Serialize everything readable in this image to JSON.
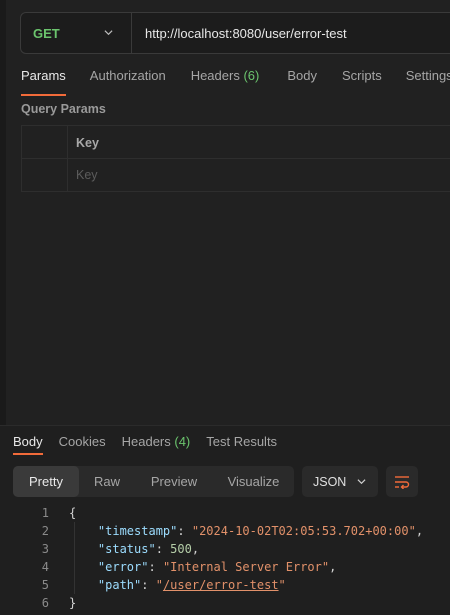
{
  "request": {
    "method": "GET",
    "url": "http://localhost:8080/user/error-test"
  },
  "request_tabs": [
    {
      "label": "Params",
      "count": ""
    },
    {
      "label": "Authorization",
      "count": ""
    },
    {
      "label": "Headers ",
      "count": "(6)"
    },
    {
      "label": "Body",
      "count": ""
    },
    {
      "label": "Scripts",
      "count": ""
    },
    {
      "label": "Settings",
      "count": ""
    }
  ],
  "query_params": {
    "title": "Query Params",
    "key_header": "Key",
    "key_placeholder": "Key"
  },
  "response_tabs": [
    {
      "label": "Body",
      "count": ""
    },
    {
      "label": "Cookies",
      "count": ""
    },
    {
      "label": "Headers ",
      "count": "(4)"
    },
    {
      "label": "Test Results",
      "count": ""
    }
  ],
  "format_tabs": [
    "Pretty",
    "Raw",
    "Preview",
    "Visualize"
  ],
  "format_selected": "Pretty",
  "language_select": "JSON",
  "code_lines": [
    {
      "num": "1",
      "parts": [
        {
          "t": "p",
          "v": "{"
        }
      ]
    },
    {
      "num": "2",
      "parts": [
        {
          "t": "p",
          "v": "    "
        },
        {
          "t": "k",
          "v": "\"timestamp\""
        },
        {
          "t": "p",
          "v": ": "
        },
        {
          "t": "s",
          "v": "\"2024-10-02T02:05:53.702+00:00\""
        },
        {
          "t": "p",
          "v": ","
        }
      ]
    },
    {
      "num": "3",
      "parts": [
        {
          "t": "p",
          "v": "    "
        },
        {
          "t": "k",
          "v": "\"status\""
        },
        {
          "t": "p",
          "v": ": "
        },
        {
          "t": "n",
          "v": "500"
        },
        {
          "t": "p",
          "v": ","
        }
      ]
    },
    {
      "num": "4",
      "parts": [
        {
          "t": "p",
          "v": "    "
        },
        {
          "t": "k",
          "v": "\"error\""
        },
        {
          "t": "p",
          "v": ": "
        },
        {
          "t": "s",
          "v": "\"Internal Server Error\""
        },
        {
          "t": "p",
          "v": ","
        }
      ]
    },
    {
      "num": "5",
      "parts": [
        {
          "t": "p",
          "v": "    "
        },
        {
          "t": "k",
          "v": "\"path\""
        },
        {
          "t": "p",
          "v": ": "
        },
        {
          "t": "s",
          "v": "\""
        },
        {
          "t": "u",
          "v": "/user/error-test"
        },
        {
          "t": "s",
          "v": "\""
        }
      ]
    },
    {
      "num": "6",
      "parts": [
        {
          "t": "p",
          "v": "}"
        }
      ]
    }
  ],
  "colors": {
    "method": "#6bc46d",
    "accent": "#f26b3a",
    "count": "#6bc46d",
    "json_key": "#9cdcfe",
    "json_string": "#e2916a",
    "json_number": "#b5cea8"
  },
  "icons": {
    "method_dropdown": "chevron-down-icon",
    "language_dropdown": "chevron-down-icon",
    "wrap": "wrap-lines-icon"
  }
}
